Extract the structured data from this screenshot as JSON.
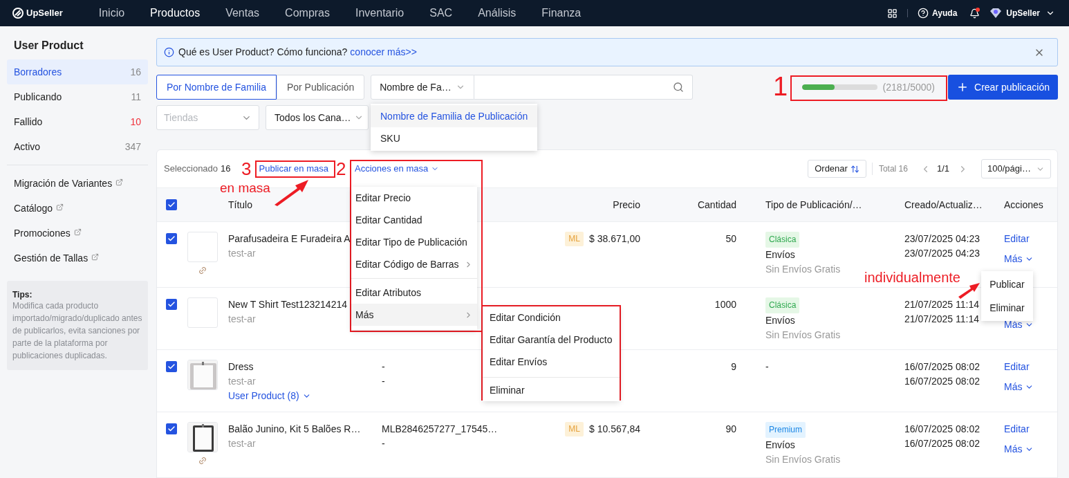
{
  "nav": {
    "logo": "UpSeller",
    "items": [
      {
        "label": "Inicio",
        "selected": false
      },
      {
        "label": "Productos",
        "selected": true
      },
      {
        "label": "Ventas",
        "selected": false
      },
      {
        "label": "Compras",
        "selected": false
      },
      {
        "label": "Inventario",
        "selected": false
      },
      {
        "label": "SAC",
        "selected": false
      },
      {
        "label": "Análisis",
        "selected": false
      },
      {
        "label": "Finanza",
        "selected": false
      }
    ],
    "help": "Ayuda",
    "notification": true,
    "account": "UpSeller"
  },
  "sidebar": {
    "title": "User Product",
    "items": [
      {
        "label": "Borradores",
        "count": "16",
        "selected": true,
        "alert": false
      },
      {
        "label": "Publicando",
        "count": "11",
        "selected": false,
        "alert": false
      },
      {
        "label": "Fallido",
        "count": "10",
        "selected": false,
        "alert": true
      },
      {
        "label": "Activo",
        "count": "347",
        "selected": false,
        "alert": false
      }
    ],
    "links": [
      {
        "label": "Migración de Variantes"
      },
      {
        "label": "Catálogo"
      },
      {
        "label": "Promociones"
      },
      {
        "label": "Gestión de Tallas"
      }
    ],
    "tips": {
      "title": "Tips:",
      "text": "Modifica cada producto importado/migrado/duplicado antes de publicarlos, evita sanciones por parte de la plataforma por publicaciones duplicadas."
    }
  },
  "banner": {
    "text": "Qué es User Product? Cómo funciona?",
    "link": "conocer más>>"
  },
  "filters": {
    "modes": [
      {
        "label": "Por Nombre de Familia",
        "selected": true
      },
      {
        "label": "Por Publicación",
        "selected": false
      }
    ],
    "search_type": "Nombre de Fa…",
    "store": {
      "placeholder": "Tiendas"
    },
    "channel": "Todos los Cana…"
  },
  "quota": {
    "level": 0.436,
    "reading": "(2181/5000)"
  },
  "create_button": "Crear publicación",
  "search_type_menu": [
    {
      "label": "Nombre de Familia de Publicación",
      "selected": true
    },
    {
      "label": "SKU",
      "selected": false
    }
  ],
  "toolbar": {
    "selected_label": "Seleccionado",
    "selected_count": "16",
    "bulk_publish": "Publicar en masa",
    "bulk_actions": "Acciones en masa",
    "sort": "Ordenar",
    "total": "Total 16",
    "page": "1/1",
    "page_size": "100/pági…"
  },
  "table": {
    "all_checked": true,
    "columns": [
      {
        "label": "Título"
      },
      {
        "label": "Precio"
      },
      {
        "label": "Cantidad"
      },
      {
        "label": "Tipo de Publicación/…"
      },
      {
        "label": "Creado/Actualiz…"
      },
      {
        "label": "Acciones"
      }
    ],
    "rows": [
      {
        "checked": true,
        "photo": false,
        "linked": true,
        "title": "Parafusadeira E Furadeira A",
        "store": "test-ar",
        "channel": "ML",
        "price": "$ 38.671,00",
        "quantity": "50",
        "listing": {
          "label": "Clásica",
          "kind": "classic"
        },
        "shipping": "Envíos",
        "free_shipping": "Sin Envíos Gratis",
        "created": "23/07/2025 04:23",
        "updated": "23/07/2025 04:23",
        "actions": [
          "Editar",
          "Más"
        ]
      },
      {
        "checked": true,
        "photo": false,
        "linked": false,
        "title": "New T Shirt Test123214214",
        "store": "test-ar",
        "quantity": "1000",
        "listing": {
          "label": "Clásica",
          "kind": "classic"
        },
        "shipping": "Envíos",
        "free_shipping": "Sin Envíos Gratis",
        "created": "21/07/2025 11:14",
        "updated": "21/07/2025 11:14",
        "actions": [
          "Más"
        ]
      },
      {
        "checked": true,
        "photo": true,
        "linked": false,
        "title": "Dress",
        "store": "test-ar",
        "variants": "User Product (8)",
        "sku": [
          "-",
          "-"
        ],
        "quantity": "9",
        "listing_none": "-",
        "created": "16/07/2025 08:02",
        "updated": "16/07/2025 08:02",
        "actions": [
          "Editar",
          "Más"
        ]
      },
      {
        "checked": true,
        "photo": true,
        "linked": true,
        "title": "Balão Junino, Kit 5 Balões R…",
        "store": "test-ar",
        "sku": [
          "MLB2846257277_17545…",
          "-"
        ],
        "channel": "ML",
        "price": "$ 10.567,84",
        "quantity": "90",
        "listing": {
          "label": "Premium",
          "kind": "premium"
        },
        "shipping": "Envíos",
        "free_shipping": "Sin Envíos Gratis",
        "created": "16/07/2025 08:02",
        "updated": "16/07/2025 08:02",
        "actions": [
          "Editar",
          "Más"
        ]
      }
    ]
  },
  "bulk_menu": [
    {
      "label": "Editar Precio",
      "submenu": false,
      "hovered": false,
      "divider_before": false
    },
    {
      "label": "Editar Cantidad",
      "submenu": false,
      "hovered": false,
      "divider_before": false
    },
    {
      "label": "Editar Tipo de Publicación",
      "submenu": false,
      "hovered": false,
      "divider_before": false
    },
    {
      "label": "Editar Código de Barras",
      "submenu": true,
      "hovered": false,
      "divider_before": false
    },
    {
      "label": "Editar Atributos",
      "submenu": false,
      "hovered": false,
      "divider_before": true
    },
    {
      "label": "Más",
      "submenu": true,
      "hovered": true,
      "divider_before": false
    }
  ],
  "more_submenu": [
    {
      "label": "Editar Condición",
      "divider_before": false
    },
    {
      "label": "Editar Garantía del Producto",
      "divider_before": false
    },
    {
      "label": "Editar Envíos",
      "divider_before": false
    },
    {
      "label": "Eliminar",
      "divider_before": true
    }
  ],
  "row_menu": [
    "Publicar",
    "Eliminar"
  ],
  "annotations": {
    "numbers": [
      "1",
      "2",
      "3"
    ],
    "callouts": [
      "en masa",
      "individualmente"
    ]
  }
}
